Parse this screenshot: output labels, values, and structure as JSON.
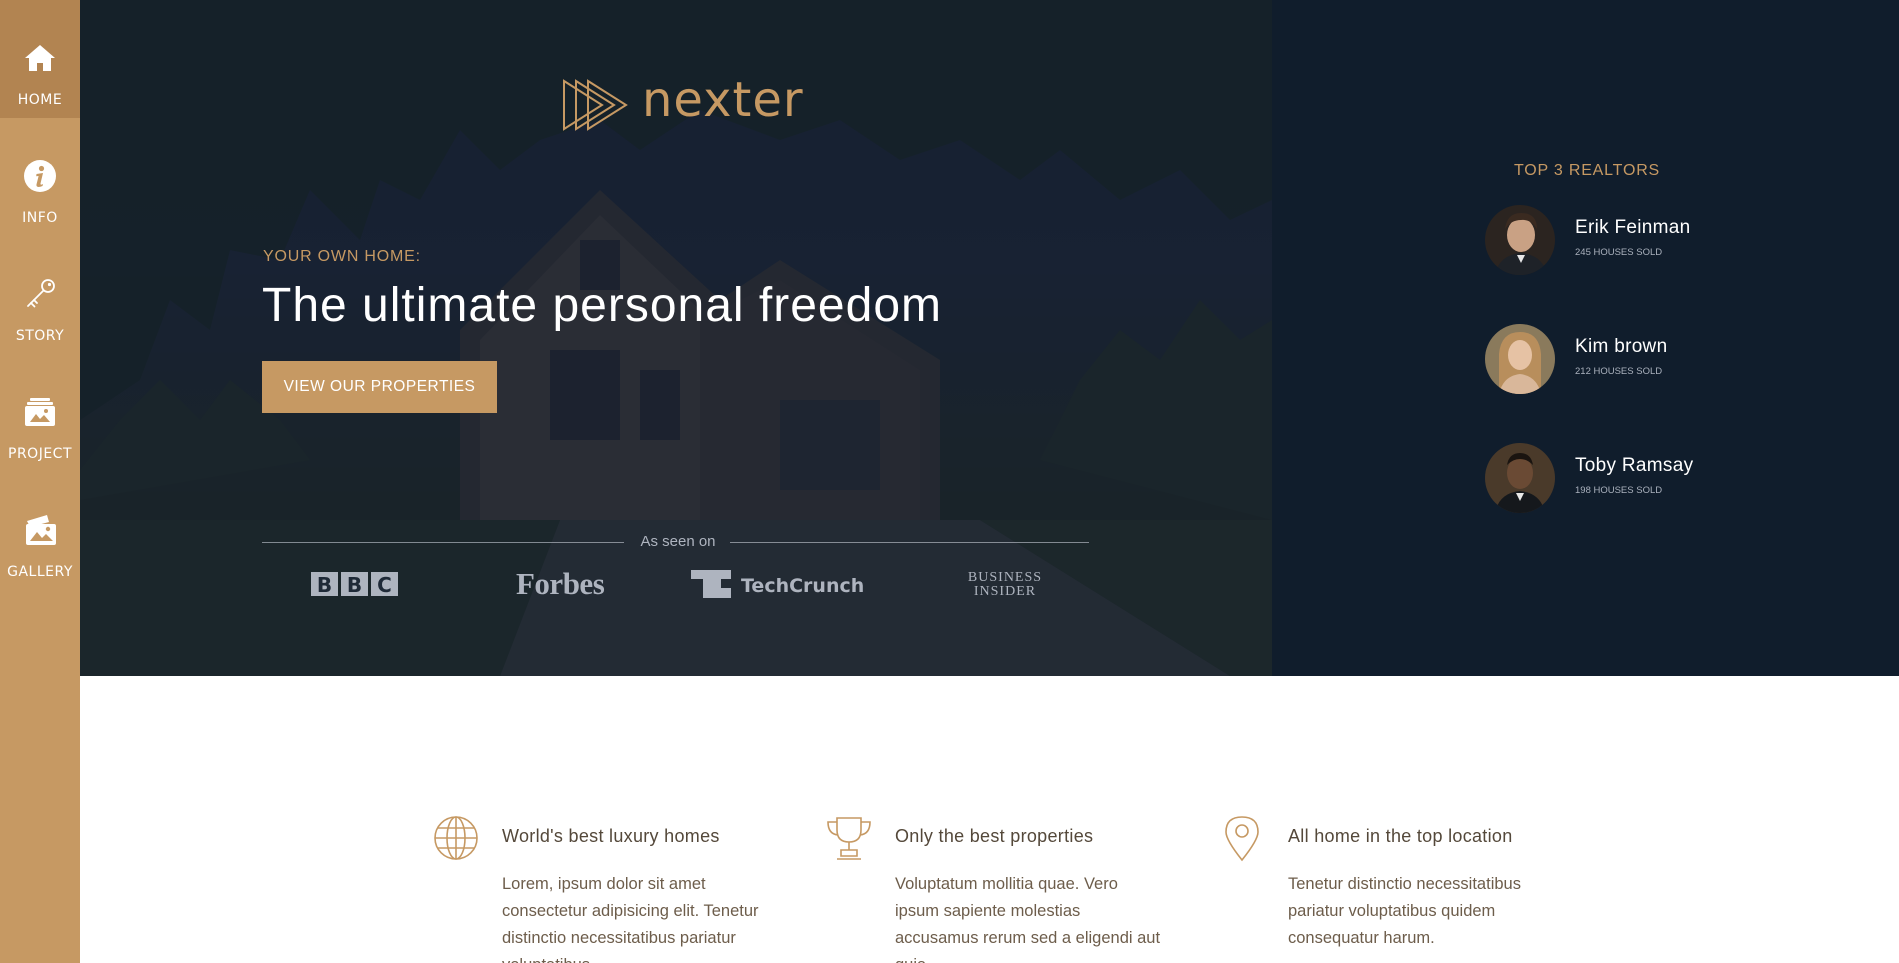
{
  "sidebar": {
    "items": [
      {
        "label": "HOME",
        "icon": "home-icon"
      },
      {
        "label": "INFO",
        "icon": "info-icon"
      },
      {
        "label": "STORY",
        "icon": "key-icon"
      },
      {
        "label": "PROJECT",
        "icon": "project-icon"
      },
      {
        "label": "GALLERY",
        "icon": "gallery-icon"
      }
    ],
    "active": "HOME"
  },
  "hero": {
    "logo_text": "nexter",
    "eyebrow": "YOUR OWN HOME:",
    "headline": "The ultimate personal freedom",
    "cta_label": "VIEW OUR PROPERTIES",
    "seen_on_label": "As seen on",
    "press": [
      {
        "name": "BBC",
        "text": "BBC"
      },
      {
        "name": "Forbes",
        "text": "Forbes"
      },
      {
        "name": "TechCrunch",
        "text": "TechCrunch"
      },
      {
        "name": "Business Insider",
        "text": "BUSINESS INSIDER"
      }
    ]
  },
  "realtors": {
    "title": "TOP 3 REALTORS",
    "list": [
      {
        "name": "Erik Feinman",
        "sold": "245 HOUSES SOLD"
      },
      {
        "name": "Kim brown",
        "sold": "212 HOUSES SOLD"
      },
      {
        "name": "Toby Ramsay",
        "sold": "198 HOUSES SOLD"
      }
    ]
  },
  "features": [
    {
      "icon": "globe-icon",
      "title": "World's best luxury homes",
      "body": "Lorem, ipsum dolor sit amet consectetur adipisicing elit. Tenetur distinctio necessitatibus pariatur voluptatibus."
    },
    {
      "icon": "trophy-icon",
      "title": "Only the best properties",
      "body": "Voluptatum mollitia quae. Vero ipsum sapiente molestias accusamus rerum sed a eligendi aut quia."
    },
    {
      "icon": "map-pin-icon",
      "title": "All home in the top location",
      "body": "Tenetur distinctio necessitatibus pariatur voluptatibus quidem consequatur harum."
    }
  ],
  "colors": {
    "accent": "#c69963",
    "accent_dark": "#b28451",
    "navy": "#101d2c",
    "feature_title": "#54483a",
    "feature_body": "#6d5d4b"
  }
}
